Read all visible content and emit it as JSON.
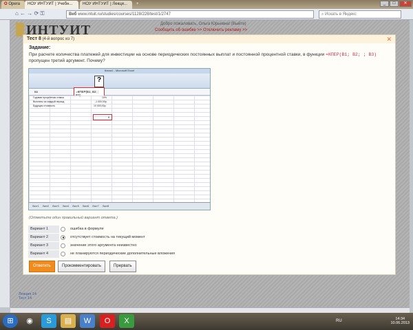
{
  "browser": {
    "tabs": [
      {
        "label": "Opera"
      },
      {
        "label": "НОУ ИНТУИТ | Учебн..."
      },
      {
        "label": "НОУ ИНТУИТ | Лекци..."
      }
    ],
    "address_prefix": "Веб",
    "url": "www.intuit.ru/studies/courses/1128/228/test/1/2747",
    "search_placeholder": "Искать в Яндекс"
  },
  "site": {
    "logo": "ИНТУИТ",
    "welcome": "Добро пожаловать, Ольга Юрьевна! (Выйти)",
    "links": "Сообщить об ошибке >>   Отключить рекламу >>"
  },
  "dialog": {
    "title": "Тест 8",
    "subtitle": "(4-й вопрос из 7)",
    "task_label": "Задание:",
    "question": "При расчете количества платежей для инвестиции на основе периодических постоянных выплат и постоянной процентной ставки, в функции ",
    "formula": "=КПЕР(B1; B2; ; B3)",
    "question_end": " пропущен третий аргумент. Почему?",
    "excel": {
      "title": "Книга1 - Microsoft Excel",
      "formula_bar": "=КПЕР(B1; B2; ; B3)",
      "cell_ref": "B5",
      "rows": [
        {
          "label": "Годовая процентная ставка",
          "value": "10%"
        },
        {
          "label": "Выплаты за каждый период",
          "value": "-1 000,00р."
        },
        {
          "label": "Будущая стоимость",
          "value": "10 000,00р."
        }
      ],
      "result": "8",
      "sheets": "Лист1 Лист2 Лист3 Лист4 Лист5 Лист6 Лист7 Лист8"
    },
    "hint": "(Отметьте один правильный вариант ответа.)",
    "options": [
      {
        "label": "Вариант 1",
        "text": "ошибка в формуле",
        "selected": false
      },
      {
        "label": "Вариант 2",
        "text": "отсутствует стоимость на текущий момент",
        "selected": true
      },
      {
        "label": "Вариант 3",
        "text": "значение этого аргумента неизвестно",
        "selected": false
      },
      {
        "label": "Вариант 4",
        "text": "не планируются периодические дополнительные вложения",
        "selected": false
      }
    ],
    "buttons": {
      "answer": "Ответить",
      "comment": "Прокомментировать",
      "abort": "Прервать"
    }
  },
  "page_links": [
    "Лекция 14",
    "Тест 14"
  ],
  "taskbar": {
    "lang": "RU",
    "time": "14:34",
    "date": "10.06.2013"
  },
  "colors": {
    "accent": "#f08c1e",
    "formula": "#c4304a",
    "error_link": "#b01818"
  }
}
